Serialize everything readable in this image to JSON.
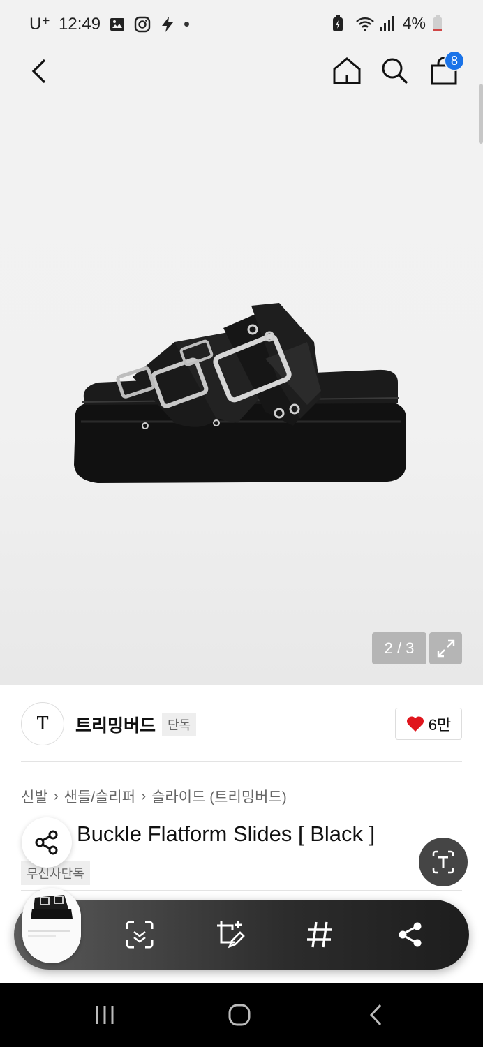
{
  "status_bar": {
    "carrier": "U⁺",
    "time": "12:49",
    "battery": "4%",
    "left_icons": [
      "gallery-icon",
      "instagram-icon",
      "flash-icon"
    ],
    "right_icons": [
      "battery-saver-icon",
      "wifi-icon",
      "signal-icon",
      "battery-icon"
    ]
  },
  "header": {
    "cart_count": "8",
    "icons": [
      "back-icon",
      "home-icon",
      "search-icon",
      "cart-icon"
    ]
  },
  "gallery": {
    "counter": "2 / 3",
    "expand_icon": "expand-icon"
  },
  "brand": {
    "logo_text": "T",
    "name": "트리밍버드",
    "tag": "단독",
    "likes": "6만",
    "heart_color": "#e0161d"
  },
  "breadcrumb": [
    "신발",
    "샌들/슬리퍼",
    "슬라이드 (트리밍버드)"
  ],
  "product": {
    "title": "Buckle Flatform Slides [ Black ]",
    "badge": "무신사단독"
  },
  "capture_toolbar": {
    "icons": [
      "scan-icon",
      "edit-crop-icon",
      "hashtag-icon",
      "share-icon"
    ]
  },
  "colors": {
    "badge_blue": "#1a73e8",
    "toolbar_dark": "#2c2c2c"
  }
}
